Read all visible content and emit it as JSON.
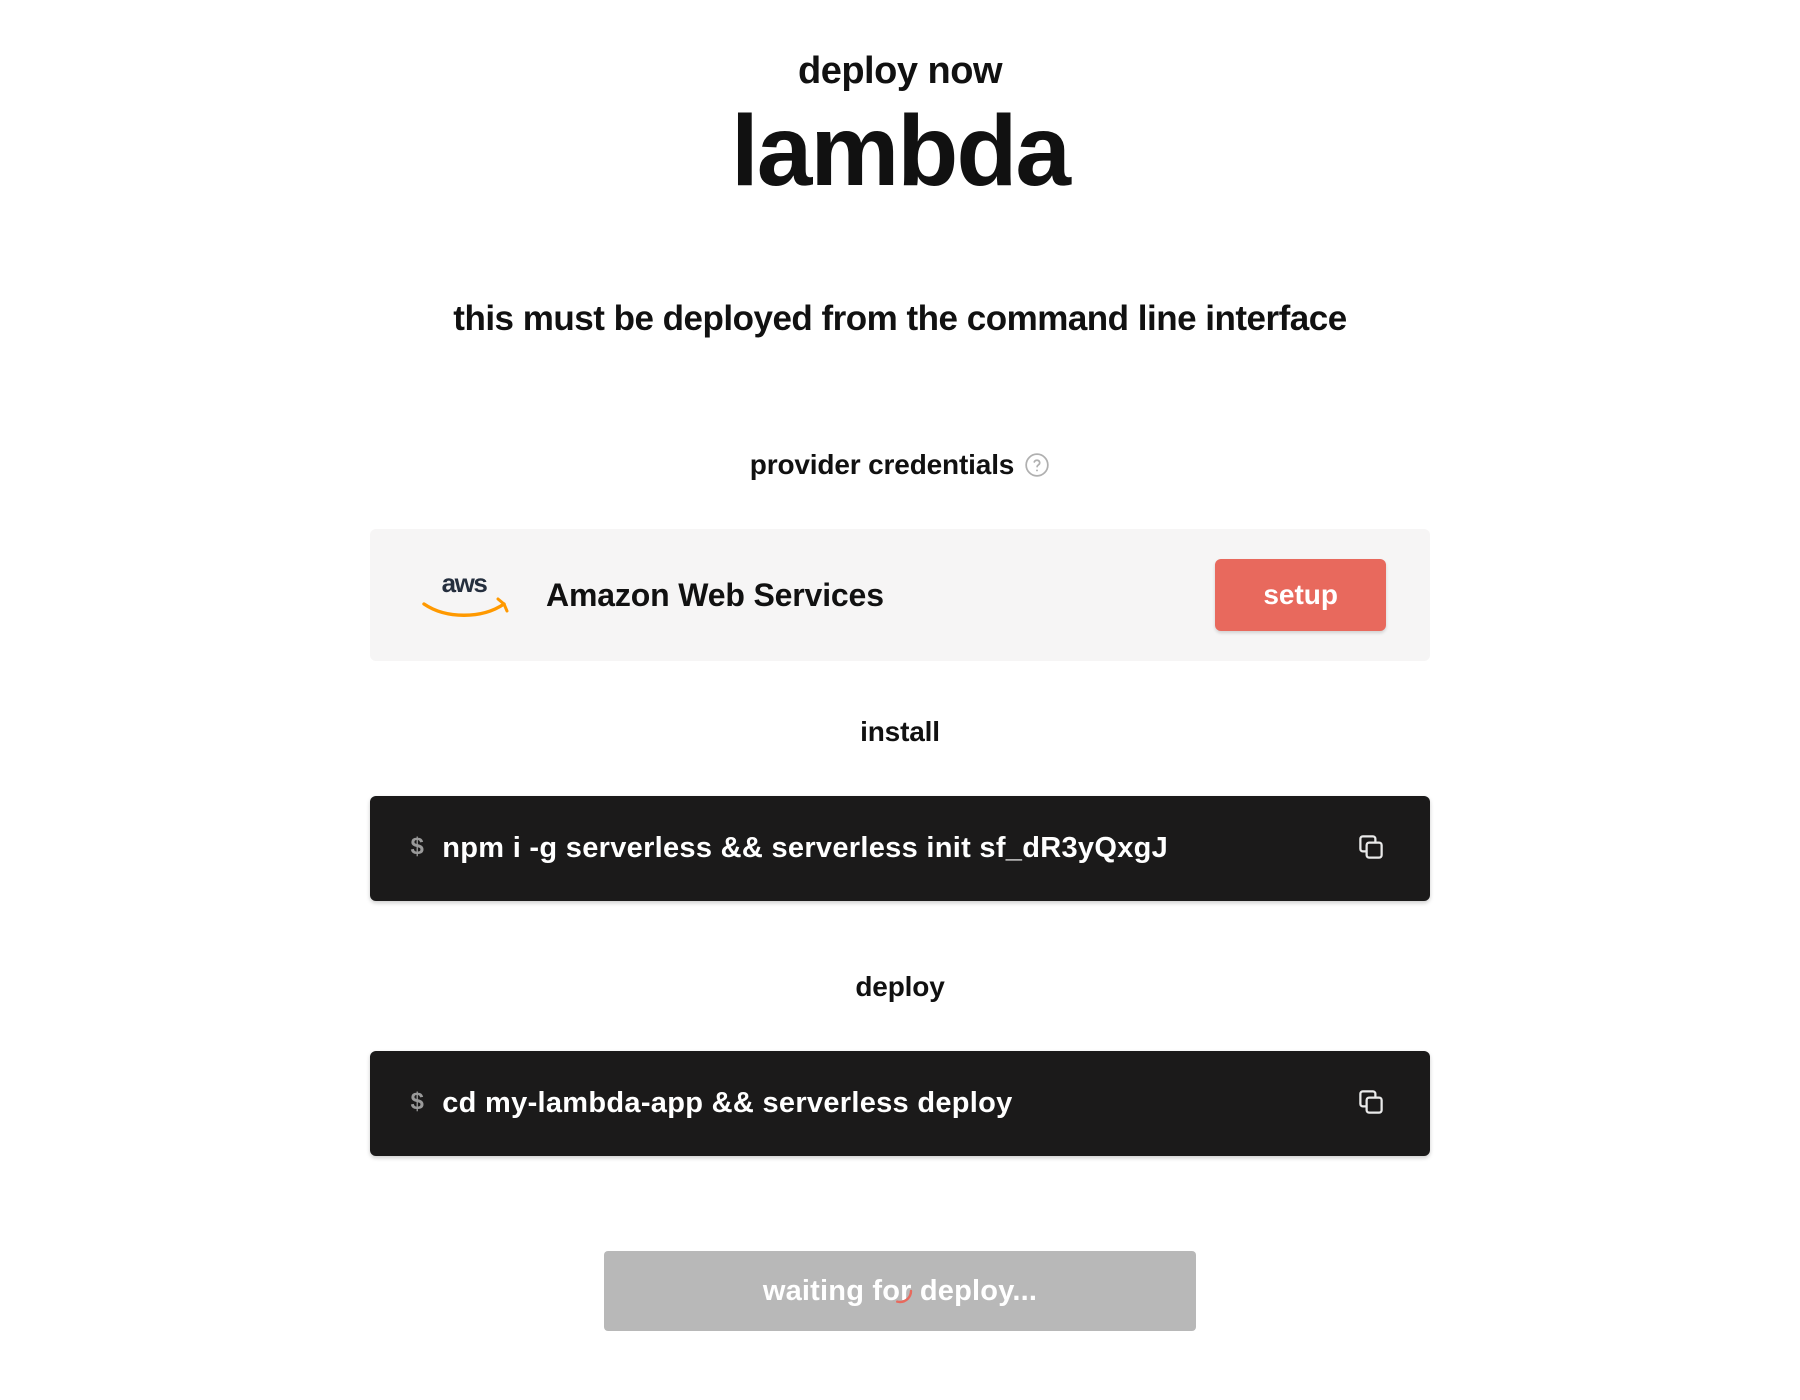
{
  "header": {
    "kicker": "deploy now",
    "title": "lambda",
    "subtitle": "this must be deployed from the command line interface"
  },
  "sections": {
    "credentials": {
      "label": "provider credentials",
      "provider_name": "Amazon Web Services",
      "setup_label": "setup"
    },
    "install": {
      "label": "install",
      "prompt": "$",
      "command": "npm i -g serverless && serverless init sf_dR3yQxgJ"
    },
    "deploy": {
      "label": "deploy",
      "prompt": "$",
      "command": "cd my-lambda-app && serverless deploy"
    }
  },
  "waiting": {
    "label": "waiting for deploy..."
  },
  "colors": {
    "accent": "#e8695d",
    "code_bg": "#1b1a1a",
    "card_bg": "#f6f5f5",
    "waiting_bg": "#b8b8b8",
    "aws_orange": "#FF9900"
  }
}
